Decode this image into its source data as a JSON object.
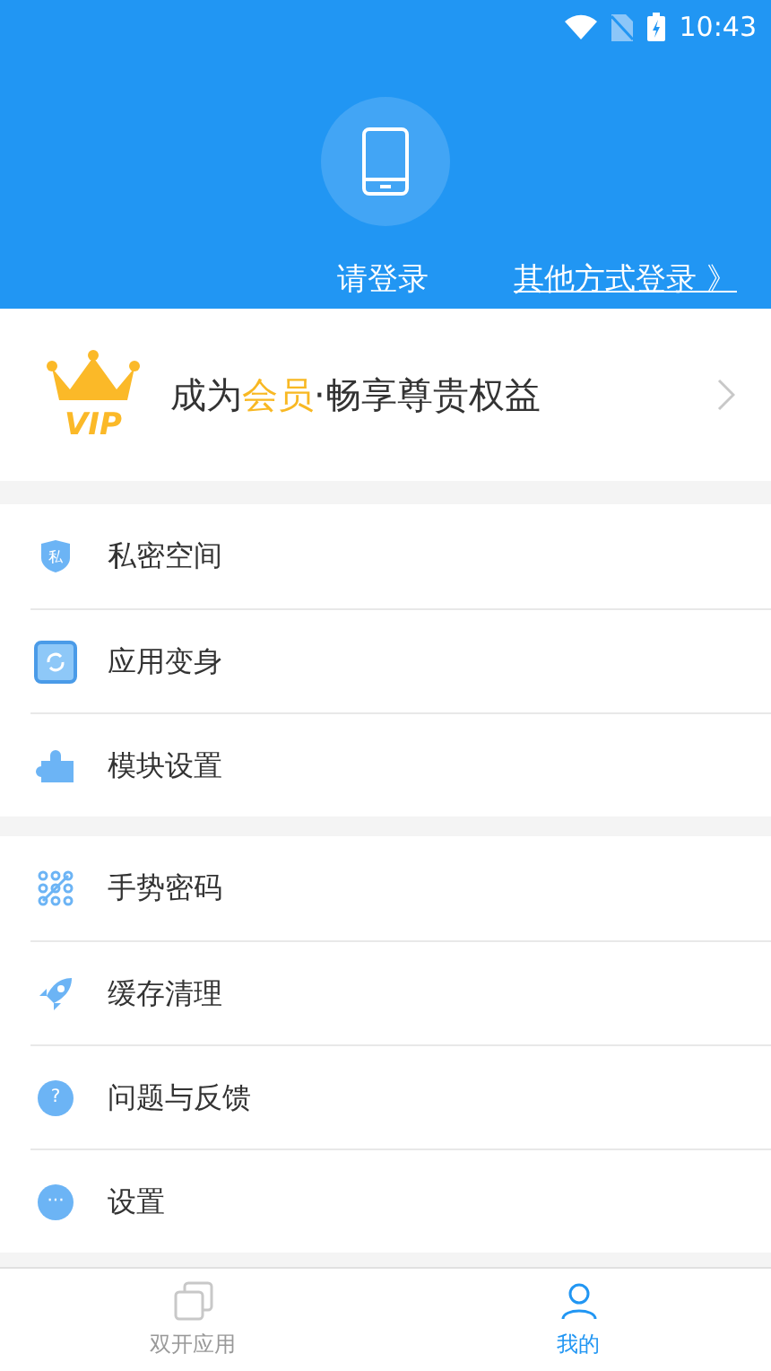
{
  "status_bar": {
    "time": "10:43"
  },
  "header": {
    "login": "请登录",
    "other_login": "其他方式登录 》"
  },
  "vip_banner": {
    "badge": "VIP",
    "parts": [
      {
        "text": "成为",
        "highlight": false
      },
      {
        "text": "会员",
        "highlight": true
      },
      {
        "text": "·畅享尊贵权益",
        "highlight": false
      }
    ]
  },
  "menu_groups": [
    [
      {
        "kind": "shield",
        "label": "私密空间",
        "icon_text": "私"
      },
      {
        "kind": "swap",
        "label": "应用变身"
      },
      {
        "kind": "puzzle",
        "label": "模块设置"
      }
    ],
    [
      {
        "kind": "pattern",
        "label": "手势密码"
      },
      {
        "kind": "rocket",
        "label": "缓存清理"
      },
      {
        "kind": "help",
        "label": "问题与反馈",
        "icon_text": "?"
      },
      {
        "kind": "more",
        "label": "设置",
        "icon_text": "···"
      }
    ]
  ],
  "tab_bar": [
    {
      "kind": "apps",
      "label": "双开应用",
      "selected": false
    },
    {
      "kind": "person",
      "label": "我的",
      "selected": true
    }
  ]
}
